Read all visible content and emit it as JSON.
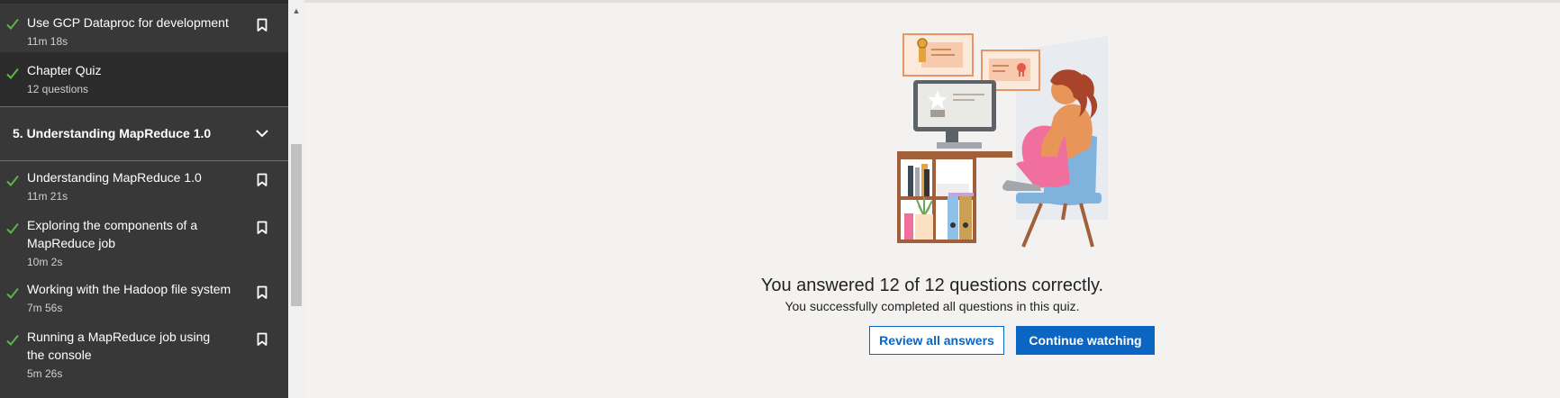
{
  "sidebar": {
    "items_top": [
      {
        "title": "Use GCP Dataproc for development",
        "meta": "11m 18s",
        "completed": true,
        "bookmark": true
      },
      {
        "title": "Chapter Quiz",
        "meta": "12 questions",
        "completed": true,
        "bookmark": false,
        "active": true
      }
    ],
    "section": {
      "title": "5. Understanding MapReduce 1.0",
      "expanded": true
    },
    "items": [
      {
        "title": "Understanding MapReduce 1.0",
        "meta": "11m 21s",
        "completed": true,
        "bookmark": true
      },
      {
        "title": "Exploring the components of a MapReduce job",
        "meta": "10m 2s",
        "completed": true,
        "bookmark": true
      },
      {
        "title": "Working with the Hadoop file system",
        "meta": "7m 56s",
        "completed": true,
        "bookmark": true
      },
      {
        "title": "Running a MapReduce job using the console",
        "meta": "5m 26s",
        "completed": true,
        "bookmark": true
      }
    ]
  },
  "quiz_result": {
    "headline": "You answered 12 of 12 questions correctly.",
    "subtext": "You successfully completed all questions in this quiz.",
    "review_label": "Review all answers",
    "continue_label": "Continue watching"
  },
  "colors": {
    "check": "#5fb34a",
    "accent": "#0a66c2",
    "sidebar_bg": "#383838",
    "active_bg": "#2b2b2b"
  },
  "icons": {
    "completed": "checkmark-icon",
    "bookmark": "bookmark-icon",
    "collapse": "chevron-up-icon"
  }
}
